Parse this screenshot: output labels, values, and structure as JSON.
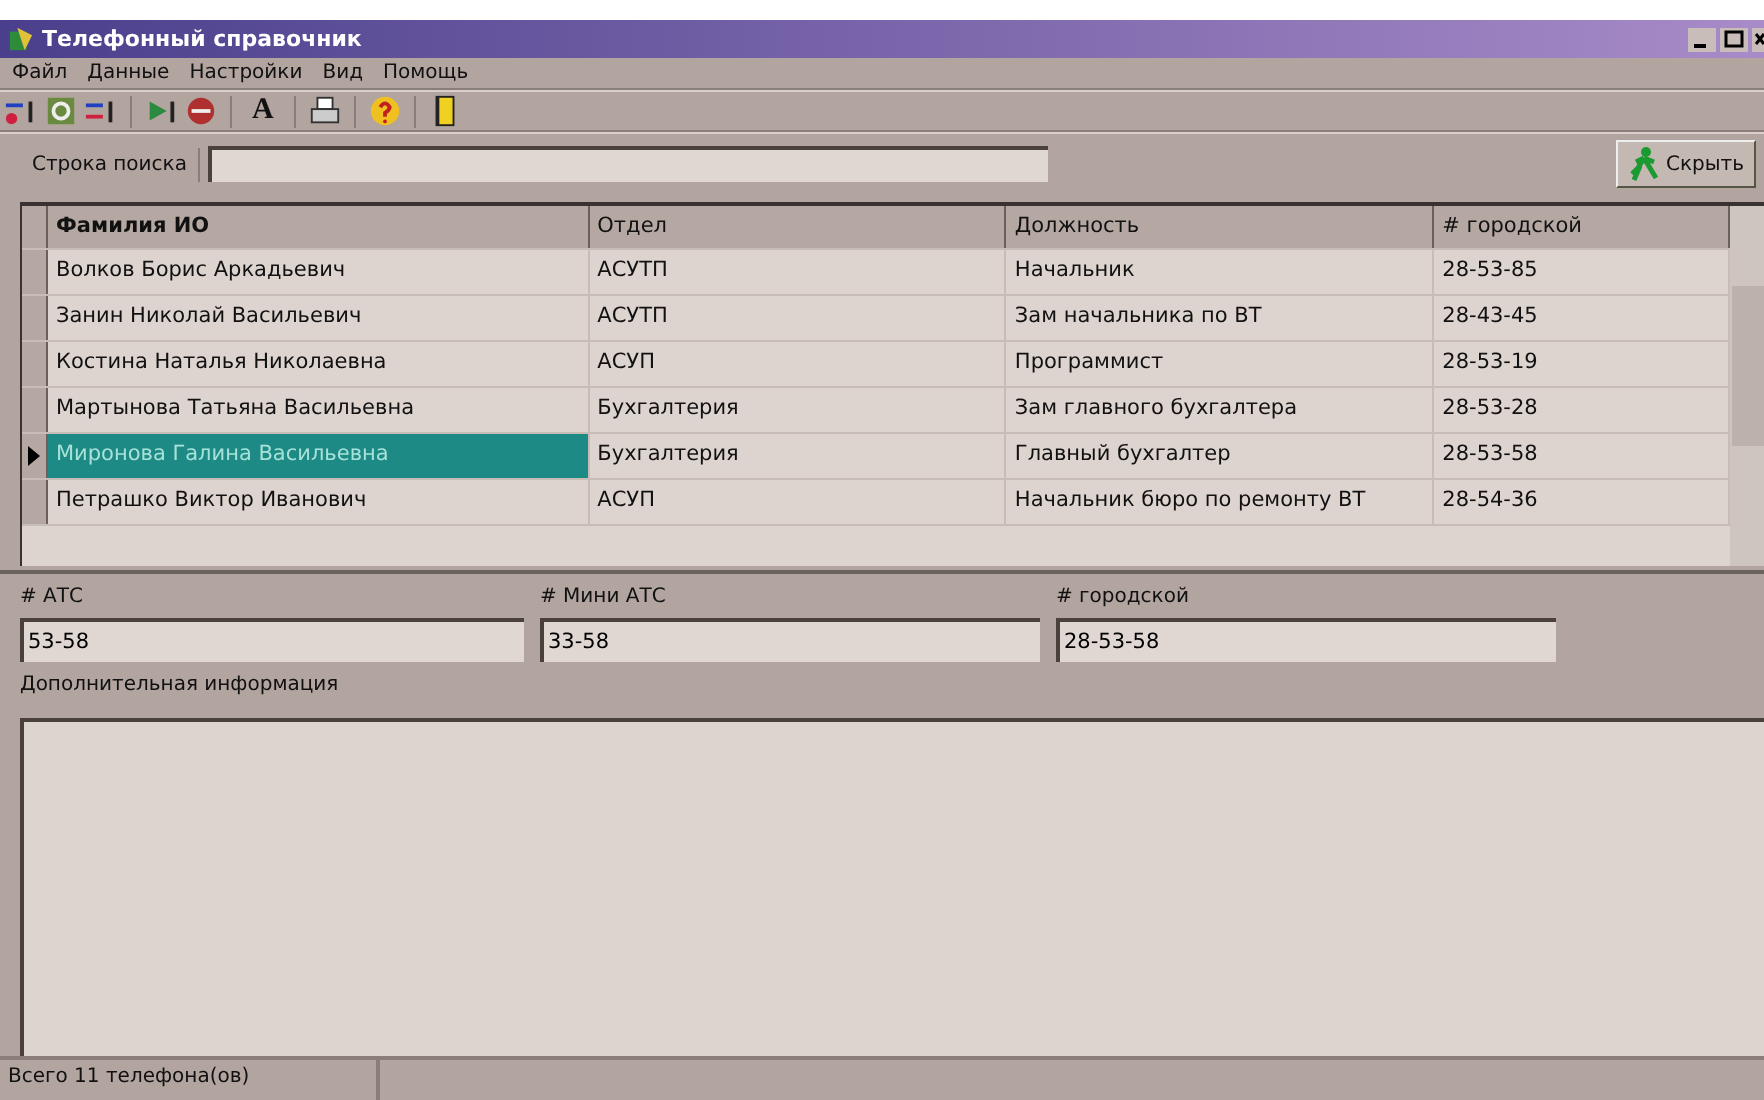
{
  "window": {
    "title": "Телефонный справочник"
  },
  "menu": [
    "Файл",
    "Данные",
    "Настройки",
    "Вид",
    "Помощь"
  ],
  "toolbar": {
    "font_button": "A"
  },
  "search": {
    "label": "Строка поиска"
  },
  "hide_button": "Скрыть",
  "table": {
    "columns": [
      "Фамилия ИО",
      "Отдел",
      "Должность",
      "# городской"
    ],
    "rows": [
      {
        "cells": [
          "Волков Борис Аркадьевич",
          "АСУТП",
          "Начальник",
          "28-53-85"
        ],
        "selected": false
      },
      {
        "cells": [
          "Занин Николай Васильевич",
          "АСУТП",
          "Зам начальника по ВТ",
          "28-43-45"
        ],
        "selected": false
      },
      {
        "cells": [
          "Костина Наталья Николаевна",
          "АСУП",
          "Программист",
          "28-53-19"
        ],
        "selected": false
      },
      {
        "cells": [
          "Мартынова Татьяна Васильевна",
          "Бухгалтерия",
          "Зам главного бухгалтера",
          "28-53-28"
        ],
        "selected": false
      },
      {
        "cells": [
          "Миронова Галина Васильевна",
          "Бухгалтерия",
          "Главный бухгалтер",
          "28-53-58"
        ],
        "selected": true
      },
      {
        "cells": [
          "Петрашко Виктор Иванович",
          "АСУП",
          "Начальник бюро по ремонту ВТ",
          "28-54-36"
        ],
        "selected": false
      }
    ]
  },
  "details": {
    "fields": [
      {
        "label": "# АТС",
        "value": "53-58"
      },
      {
        "label": "# Мини АТС",
        "value": "33-58"
      },
      {
        "label": "# городской",
        "value": "28-53-58"
      }
    ],
    "info_label": "Дополнительная информация"
  },
  "status_bar": "Всего 11 телефона(ов)"
}
